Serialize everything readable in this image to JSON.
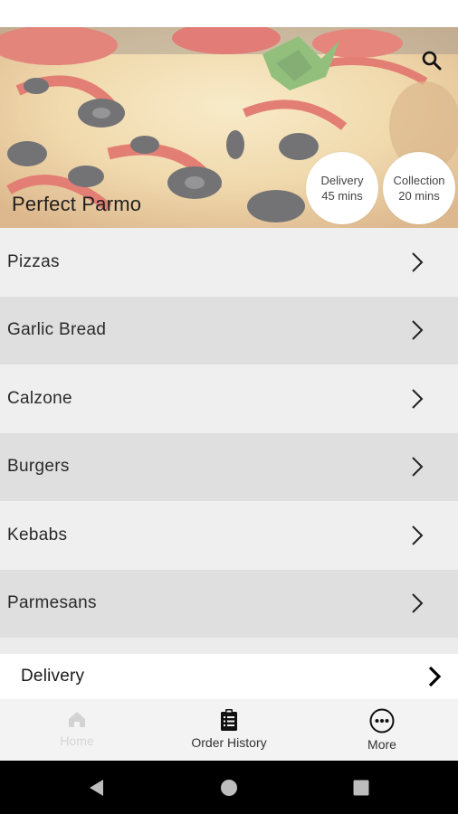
{
  "hero": {
    "title": "Perfect Parmo",
    "delivery_pill": {
      "title": "Delivery",
      "time": "45 mins"
    },
    "collection_pill": {
      "title": "Collection",
      "time": "20 mins"
    }
  },
  "menu": {
    "categories": [
      {
        "label": "Pizzas"
      },
      {
        "label": "Garlic Bread"
      },
      {
        "label": "Calzone"
      },
      {
        "label": "Burgers"
      },
      {
        "label": "Kebabs"
      },
      {
        "label": "Parmesans"
      }
    ]
  },
  "delivery_bar": {
    "label": "Delivery"
  },
  "bottom_nav": {
    "items": [
      {
        "label": "Home",
        "icon": "home-icon"
      },
      {
        "label": "Order History",
        "icon": "clipboard-icon"
      },
      {
        "label": "More",
        "icon": "more-icon"
      }
    ]
  },
  "colors": {
    "row_light": "#efefef",
    "row_dark": "#dfdfdf",
    "nav_bg": "#f3f3f3",
    "system_bar": "#000000"
  }
}
